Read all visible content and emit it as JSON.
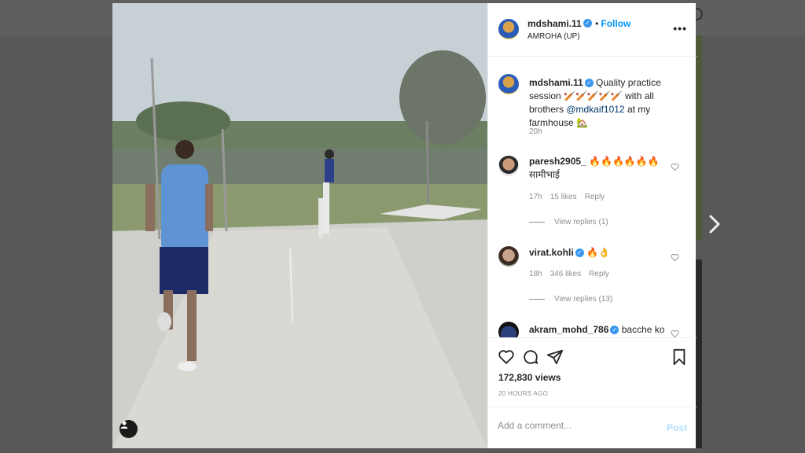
{
  "post": {
    "username": "mdshami.11",
    "follow_label": "Follow",
    "location": "AMROHA (UP)",
    "more_label": "•••",
    "caption": {
      "username": "mdshami.11",
      "text_1": "Quality practice session",
      "text_2": "🏏🏏🏏🏏🏏 with all brothers",
      "mention": "@mdkaif1012",
      "text_3": " at my farmhouse 🏡",
      "time": "20h"
    },
    "comments": [
      {
        "username": "paresh2905_",
        "text": "🔥🔥🔥🔥🔥🔥",
        "text_line2": "सामीभाई",
        "time": "17h",
        "likes": "15 likes",
        "reply": "Reply",
        "replies": "View replies (1)"
      },
      {
        "username": "virat.kohli",
        "text": "🔥👌",
        "time": "18h",
        "likes": "346 likes",
        "reply": "Reply",
        "replies": "View replies (13)"
      },
      {
        "username": "akram_mohd_786",
        "text": "bacche ko"
      }
    ],
    "views": "172,830 views",
    "time_ago": "20 HOURS AGO",
    "add_comment_placeholder": "Add a comment...",
    "post_label": "Post"
  },
  "icons": [
    "heart-icon",
    "comment-icon",
    "share-icon",
    "bookmark-icon",
    "more-icon",
    "user-tag-icon",
    "next-arrow-icon",
    "verified-badge-icon"
  ],
  "colors": {
    "link_blue": "#0095f6",
    "verified": "#3897f0",
    "post_disabled": "#b2dffc",
    "muted": "#8e8e8e"
  }
}
